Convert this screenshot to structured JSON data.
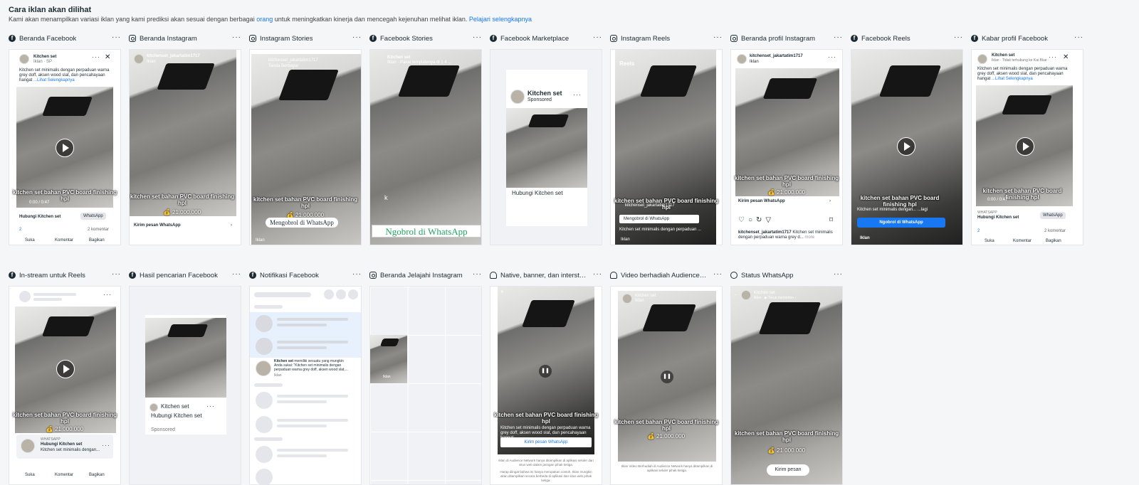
{
  "header": {
    "title": "Cara iklan akan dilihat",
    "desc_pre": "Kami akan menampilkan variasi iklan yang kami prediksi akan sesuai dengan berbagai ",
    "desc_link": "orang",
    "desc_post": " untuk meningkatkan kinerja dan mencegah kejenuhan melihat iklan. ",
    "learn_more": "Pelajari selengkapnya"
  },
  "ad": {
    "page": "Kitchen set",
    "ig_handle": "kitchenset_jakartatim1717",
    "sponsored": "Sponsored",
    "iklan": "Iklan",
    "iklan_sp": "Iklan · SP",
    "body": "Kitchen set minimalis dengan perpaduan warna grey doff, aksen wood slat, dan pencahayaan hangat",
    "see_more": "...Lihat Selengkapnya",
    "caption": "kitchen set bahan PVC board finishing hpl",
    "price": "💰 21.000.000",
    "cta_wa": "Hubungi Kitchen set",
    "send_wa": "Kirim pesan WhatsApp",
    "chat_wa": "Ngobrol di WhatsApp",
    "chat_wa2": "Mengobrol di WhatsApp",
    "whatsapp": "WhatsApp",
    "whatsapp_caps": "WHATSAPP",
    "reactions": "2",
    "comments": "2 komentar",
    "like": "Suka",
    "comment": "Komentar",
    "share": "Bagikan",
    "reels": "Reels",
    "time": "0:00 / 0:47",
    "kirim_pesan": "Kirim pesan",
    "more": "more",
    "body_short": "Kitchen set minimalis dengan...",
    "body_short2": "Kitchen set minimalis dengan perpaduan ...",
    "ig_body": "Kitchen set minimalis dengan perpaduan warna grey d...",
    "notif": "memiliki sesuatu yang mungkin Anda sukai: \"Kitchen set minimalis dengan perpaduan warna grey doff, aksen wood slat,...",
    "fb_stories_sub": "Iklan · Pakai templatenya di 1 4 ...",
    "ig_stories_sub": "Tanda Berbayar",
    "kabar_sub": "Iklan · Tidak terhubung ke Kai Blue ·",
    "k_letter": "k",
    "lagi": "...lagi",
    "status_sub": "Iklan · ▶ Terus menonton ›",
    "an_foot1": "Iklan di Audience Network hanya ditampilkan di aplikasi seluler dan situs web dalam jaringan pihak ketiga.",
    "an_foot2": "Iklan Video Berhadiah di Audience Network hanya ditampilkan di aplikasi seluler pihak ketiga.",
    "an_foot3": "Harap diingat bahwa ini hanya merupakan contoh. Iklan mungkin akan ditampilkan secara berbeda di aplikasi dan situs web pihak ketiga."
  },
  "placements": [
    {
      "name": "Beranda Facebook",
      "icon": "fb"
    },
    {
      "name": "Beranda Instagram",
      "icon": "ig"
    },
    {
      "name": "Instagram Stories",
      "icon": "ig"
    },
    {
      "name": "Facebook Stories",
      "icon": "fb"
    },
    {
      "name": "Facebook Marketplace",
      "icon": "fb"
    },
    {
      "name": "Instagram Reels",
      "icon": "ig"
    },
    {
      "name": "Beranda profil Instagram",
      "icon": "ig"
    },
    {
      "name": "Facebook Reels",
      "icon": "fb"
    },
    {
      "name": "Kabar profil Facebook",
      "icon": "fb"
    },
    {
      "name": "In-stream untuk Reels",
      "icon": "fb"
    },
    {
      "name": "Hasil pencarian Facebook",
      "icon": "fb"
    },
    {
      "name": "Notifikasi Facebook",
      "icon": "fb"
    },
    {
      "name": "Beranda Jelajahi Instagram",
      "icon": "ig"
    },
    {
      "name": "Native, banner, dan interstisial",
      "icon": "an"
    },
    {
      "name": "Video berhadiah Audience Network",
      "icon": "an"
    },
    {
      "name": "Status WhatsApp",
      "icon": "wa"
    }
  ],
  "colors": {
    "accent": "#1877f2",
    "bg": "#f5f6f7",
    "border": "#e4e6eb"
  }
}
